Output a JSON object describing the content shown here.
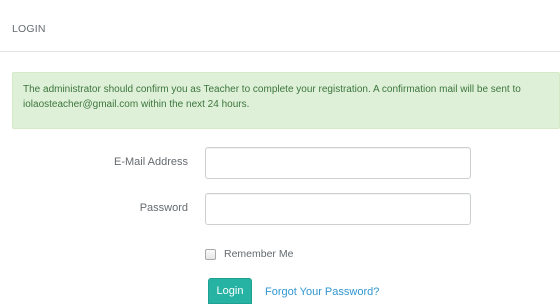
{
  "panel": {
    "heading": "LOGIN"
  },
  "alert": {
    "message": "The administrator should confirm you as Teacher to complete your registration. A confirmation mail will be sent to iolaosteacher@gmail.com within the next 24 hours."
  },
  "form": {
    "email_label": "E-Mail Address",
    "email_value": "",
    "password_label": "Password",
    "password_value": "",
    "remember_label": "Remember Me",
    "remember_checked": false,
    "login_label": "Login",
    "forgot_label": "Forgot Your Password?"
  },
  "colors": {
    "alert_background": "#dff0d8",
    "alert_text": "#3c763d",
    "primary_button": "#27b3a3",
    "link": "#3097d1"
  }
}
